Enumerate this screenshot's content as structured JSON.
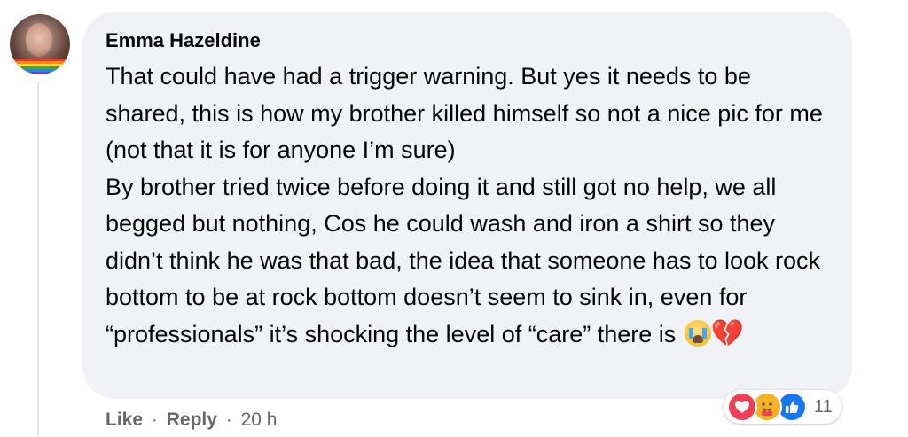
{
  "comment": {
    "author": "Emma Hazeldine",
    "paragraphs": [
      "That could have had a trigger warning. But yes it needs to be shared, this is how my brother killed himself so not a nice pic for me (not that it is for anyone I’m sure)",
      "By brother tried twice before doing it and still got no help, we all begged but nothing, Cos he could wash and iron a shirt so they didn’t think he was that bad, the idea that someone has to look rock bottom to be at rock bottom doesn’t seem to sink in, even for “professionals” it’s shocking the level of “care” there is"
    ],
    "emojis": [
      "loudly-crying-face",
      "broken-heart"
    ],
    "broken_heart_glyph": "💔"
  },
  "actions": {
    "like_label": "Like",
    "separator": "·",
    "reply_label": "Reply",
    "timestamp": "20 h"
  },
  "reactions": {
    "types": [
      "love",
      "care",
      "like"
    ],
    "count": "11",
    "colors": {
      "love": "#f33e58",
      "care": "#f7b125",
      "like": "#1877f2"
    }
  }
}
